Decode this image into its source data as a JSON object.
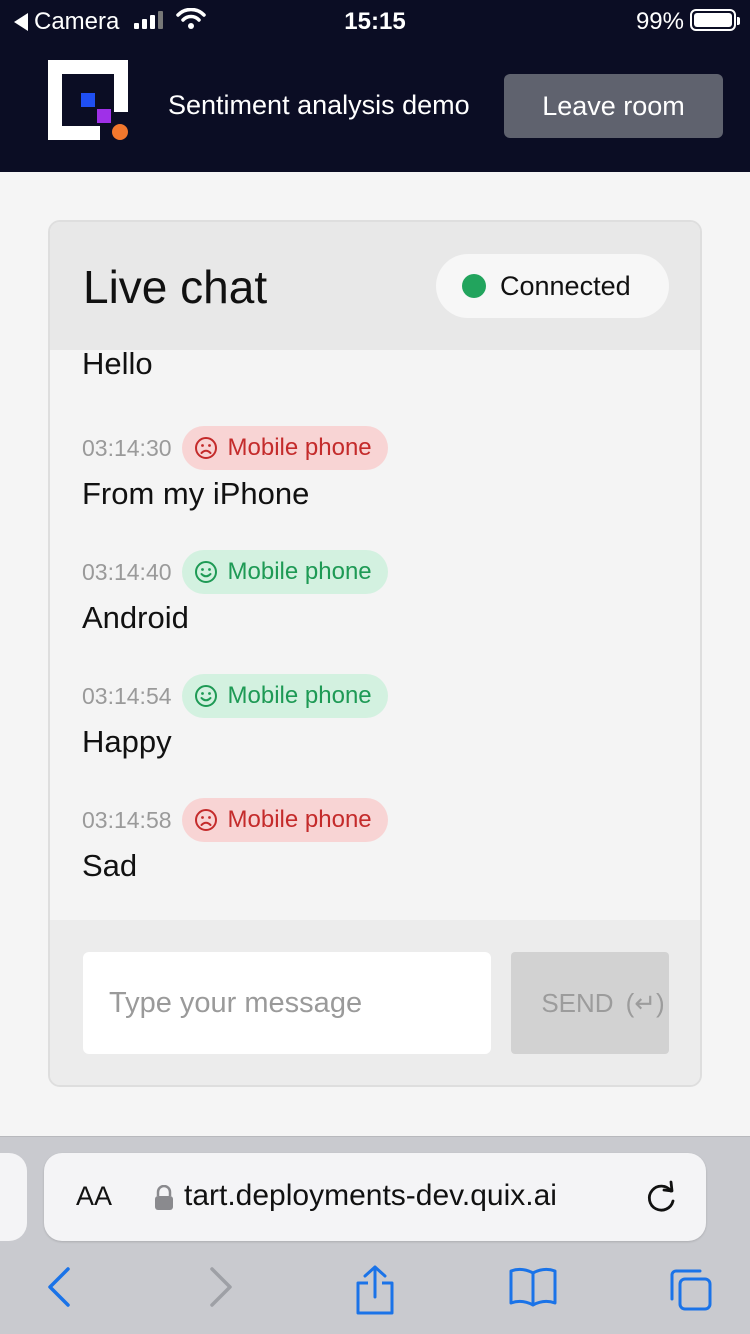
{
  "status_bar": {
    "back_label": "Camera",
    "time": "15:15",
    "battery": "99%"
  },
  "header": {
    "title": "Sentiment analysis demo",
    "leave_button": "Leave room"
  },
  "chat": {
    "title": "Live chat",
    "status": "Connected",
    "first_message": "Hello",
    "messages": [
      {
        "time": "03:14:30",
        "badge": "Mobile phone",
        "sentiment": "negative",
        "text": "From my iPhone"
      },
      {
        "time": "03:14:40",
        "badge": "Mobile phone",
        "sentiment": "positive",
        "text": "Android"
      },
      {
        "time": "03:14:54",
        "badge": "Mobile phone",
        "sentiment": "positive",
        "text": "Happy"
      },
      {
        "time": "03:14:58",
        "badge": "Mobile phone",
        "sentiment": "negative",
        "text": "Sad"
      }
    ],
    "input_placeholder": "Type your message",
    "send_label": "SEND",
    "send_hint": "(↵)"
  },
  "browser": {
    "text_size": "AA",
    "url": "tart.deployments-dev.quix.ai"
  },
  "colors": {
    "header_bg": "#0b0d24",
    "connected": "#22a45d",
    "negative": "#c42b2b",
    "positive": "#1e9a55",
    "ios_blue": "#1a73e8"
  }
}
